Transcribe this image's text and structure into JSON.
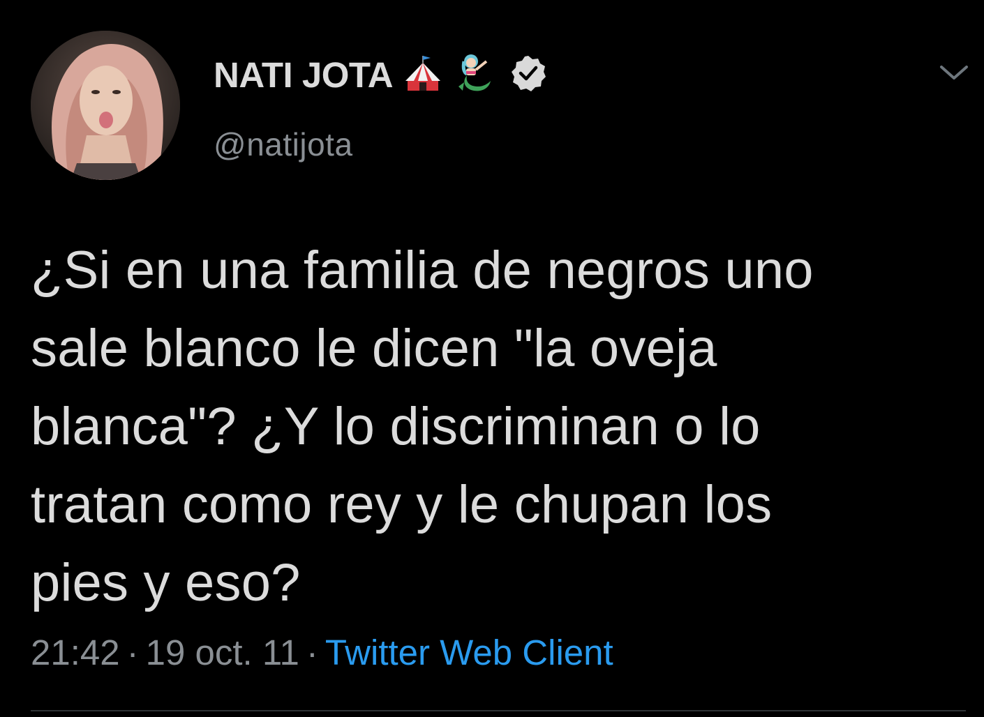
{
  "user": {
    "display_name": "NATI JOTA",
    "handle": "@natijota",
    "name_emojis": [
      "circus-tent-icon",
      "mermaid-icon"
    ],
    "verified": true
  },
  "tweet": {
    "text": "¿Si en una familia de negros uno\nsale blanco le dicen \"la oveja\nblanca\"? ¿Y lo discriminan o lo\ntratan como rey y le chupan los\npies y eso?",
    "time": "21:42",
    "date": "19 oct. 11",
    "separator": "·",
    "source": "Twitter Web Client"
  },
  "colors": {
    "background": "#000000",
    "text": "#dcdcdc",
    "secondary": "#8a8f94",
    "link": "#2a9bef"
  }
}
